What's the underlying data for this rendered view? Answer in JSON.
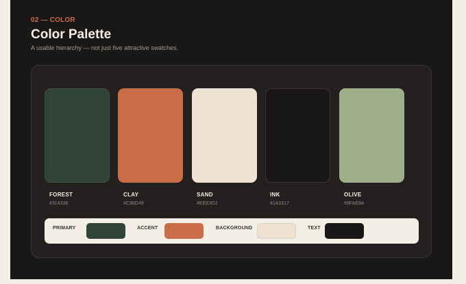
{
  "section": {
    "eyebrow": "02 — COLOR",
    "title": "Color Palette",
    "subtitle": "A usable hierarchy — not just five attractive swatches."
  },
  "swatches": [
    {
      "name": "FOREST",
      "hex": "#314338",
      "color": "#314338"
    },
    {
      "name": "CLAY",
      "hex": "#C96D49",
      "color": "#C96D49"
    },
    {
      "name": "SAND",
      "hex": "#EEE3D2",
      "color": "#EEE3D2"
    },
    {
      "name": "INK",
      "hex": "#1A1817",
      "color": "#1A1817"
    },
    {
      "name": "OLIVE",
      "hex": "#9FAE8A",
      "color": "#9FAE8A"
    }
  ],
  "roles": [
    {
      "label": "PRIMARY",
      "color": "#314338"
    },
    {
      "label": "ACCENT",
      "color": "#C96D49"
    },
    {
      "label": "BACKGROUND",
      "color": "#EEE3D2"
    },
    {
      "label": "TEXT",
      "color": "#1A1817"
    }
  ],
  "theme": {
    "page_bg": "#F3EFE7",
    "panel_bg": "#1A1717",
    "card_bg": "#242020",
    "accent": "#C96D49"
  }
}
